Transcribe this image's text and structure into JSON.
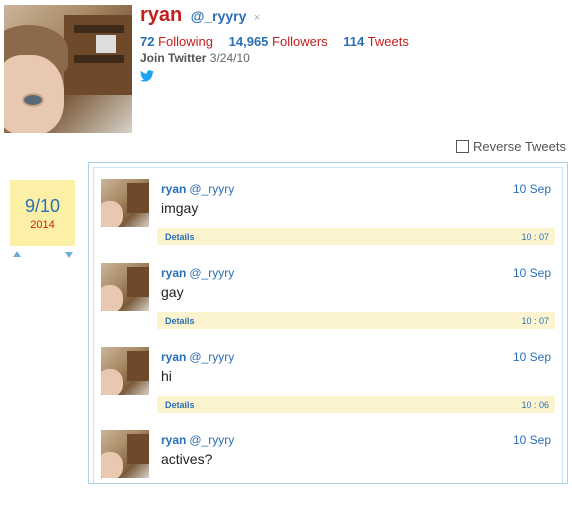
{
  "profile": {
    "name": "ryan",
    "handle": "@_ryyry",
    "close_glyph": "×",
    "following_count": "72",
    "following_label": "Following",
    "followers_count": "14,965",
    "followers_label": "Followers",
    "tweets_count": "114",
    "tweets_label": "Tweets",
    "join_label": "Join Twitter",
    "join_date": "3/24/10"
  },
  "reverse_label": "Reverse Tweets",
  "date_nav": {
    "month_day": "9/10",
    "year": "2014"
  },
  "tweets": [
    {
      "name": "ryan",
      "handle": "@_ryyry",
      "date": "10 Sep",
      "text": "imgay",
      "details": "Details",
      "time": "10 : 07"
    },
    {
      "name": "ryan",
      "handle": "@_ryyry",
      "date": "10 Sep",
      "text": "gay",
      "details": "Details",
      "time": "10 : 07"
    },
    {
      "name": "ryan",
      "handle": "@_ryyry",
      "date": "10 Sep",
      "text": "hi",
      "details": "Details",
      "time": "10 : 06"
    },
    {
      "name": "ryan",
      "handle": "@_ryyry",
      "date": "10 Sep",
      "text": "actives?",
      "details": "Details",
      "time": ""
    }
  ],
  "colors": {
    "accent_red": "#c0211d",
    "accent_blue": "#2b6fb6",
    "date_bg": "#fbf0a6",
    "details_bg": "#fbf4cf"
  },
  "icons": [
    "twitter-bird-icon",
    "arrow-up-icon",
    "arrow-down-icon",
    "close-icon"
  ]
}
